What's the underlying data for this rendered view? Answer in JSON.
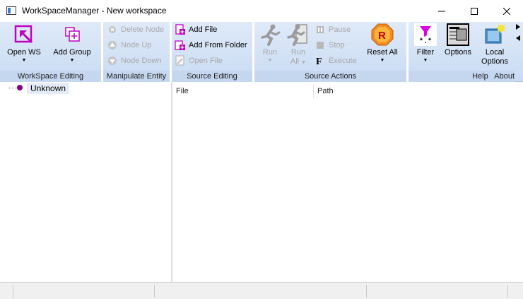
{
  "window": {
    "title": "WorkSpaceManager - New workspace",
    "controls": {
      "minimize": "minimize",
      "maximize": "maximize",
      "close": "close"
    }
  },
  "ribbon": {
    "workspace_editing": {
      "label": "WorkSpace Editing",
      "open_ws": "Open WS",
      "add_group": "Add Group"
    },
    "manipulate_entity": {
      "label": "Manipulate Entity",
      "delete_node": "Delete Node",
      "node_up": "Node Up",
      "node_down": "Node Down"
    },
    "source_editing": {
      "label": "Source Editing",
      "add_file": "Add File",
      "add_from_folder": "Add From Folder",
      "open_file": "Open File"
    },
    "source_actions": {
      "label": "Source Actions",
      "run": "Run",
      "run_all_line1": "Run",
      "run_all_line2": "All",
      "pause": "Pause",
      "stop": "Stop",
      "execute": "Execute",
      "reset_all": "Reset All"
    },
    "help": {
      "filter": "Filter",
      "options": "Options",
      "local_options_line1": "Local",
      "local_options_line2": "Options",
      "help_label": "Help",
      "about_label": "About"
    }
  },
  "tree": {
    "root": "Unknown"
  },
  "file_list": {
    "columns": [
      "File",
      "Path"
    ]
  },
  "colors": {
    "ribbon_bg": "#d4e3f6",
    "group_label_bg": "#c5d7ef",
    "accent_magenta": "#c000c0",
    "reset_orange": "#f08c1e",
    "disabled_text": "#a8a8a8"
  }
}
